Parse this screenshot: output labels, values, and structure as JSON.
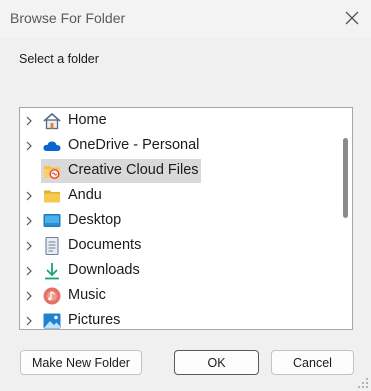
{
  "window": {
    "title": "Browse For Folder"
  },
  "dialog": {
    "prompt": "Select a folder"
  },
  "tree": {
    "items": [
      {
        "label": "Home",
        "icon": "home-icon",
        "expandable": true,
        "selected": false
      },
      {
        "label": "OneDrive - Personal",
        "icon": "onedrive-cloud-icon",
        "expandable": true,
        "selected": false
      },
      {
        "label": "Creative Cloud Files",
        "icon": "creative-cloud-folder-icon",
        "expandable": false,
        "selected": true
      },
      {
        "label": "Andu",
        "icon": "folder-icon",
        "expandable": true,
        "selected": false
      },
      {
        "label": "Desktop",
        "icon": "desktop-icon",
        "expandable": true,
        "selected": false
      },
      {
        "label": "Documents",
        "icon": "documents-icon",
        "expandable": true,
        "selected": false
      },
      {
        "label": "Downloads",
        "icon": "downloads-icon",
        "expandable": true,
        "selected": false
      },
      {
        "label": "Music",
        "icon": "music-icon",
        "expandable": true,
        "selected": false
      },
      {
        "label": "Pictures",
        "icon": "pictures-icon",
        "expandable": true,
        "selected": false
      }
    ]
  },
  "buttons": {
    "new_folder": "Make New Folder",
    "ok": "OK",
    "cancel": "Cancel"
  },
  "colors": {
    "selection": "#d9d9d9",
    "onedrive": "#0a64d2",
    "folder": "#f2c14a",
    "creative_cloud": "#e8412c",
    "downloads": "#1aa37a"
  }
}
